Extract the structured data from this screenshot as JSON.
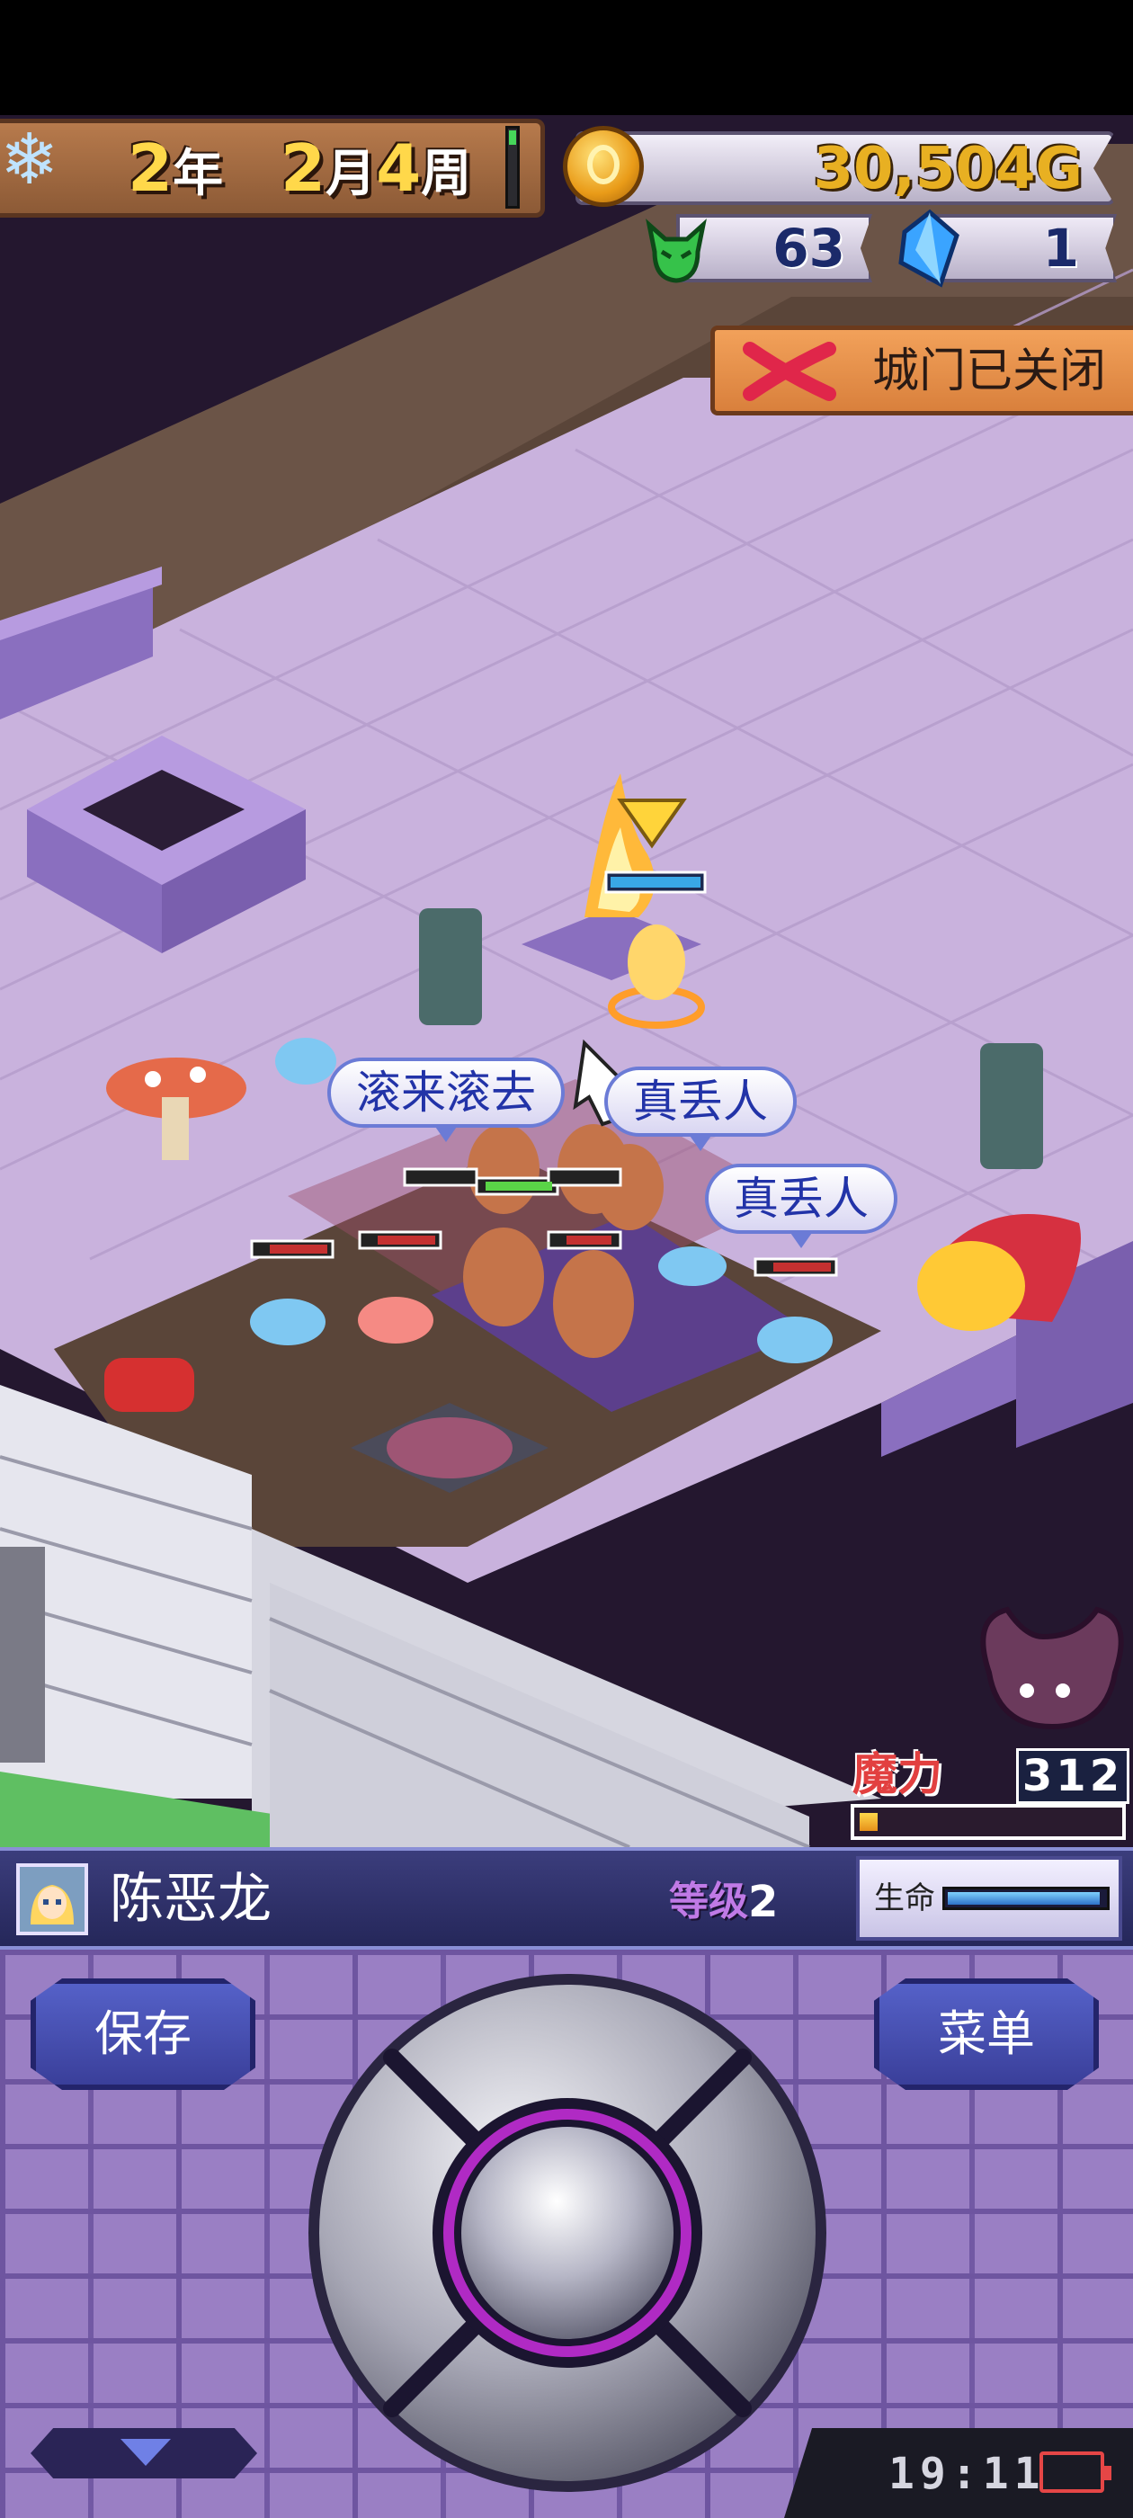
{
  "hud": {
    "year": "2",
    "year_unit": "年",
    "month": "2",
    "month_unit": "月",
    "week": "4",
    "week_unit": "周",
    "gold": "30,504G",
    "monsters": "63",
    "crystals": "1",
    "gate_status": "城门已关闭"
  },
  "speech": {
    "bubble_1": "滚来滚去",
    "bubble_2": "真丢人",
    "bubble_3": "真丢人"
  },
  "mana": {
    "label": "魔力",
    "value": "312",
    "fill_fraction": 0.07
  },
  "character": {
    "name": "陈恶龙",
    "level_label": "等级",
    "level": "2",
    "hp_label": "生命",
    "hp_fraction": 0.97
  },
  "controls": {
    "save_label": "保存",
    "menu_label": "菜单"
  },
  "status": {
    "clock": "19:11"
  },
  "colors": {
    "floor": "#c9b2dd",
    "wall": "#8a6fbf",
    "hud_gold": "#e8b022",
    "button_blue": "#4a52b6",
    "mana_red": "#e24040"
  }
}
